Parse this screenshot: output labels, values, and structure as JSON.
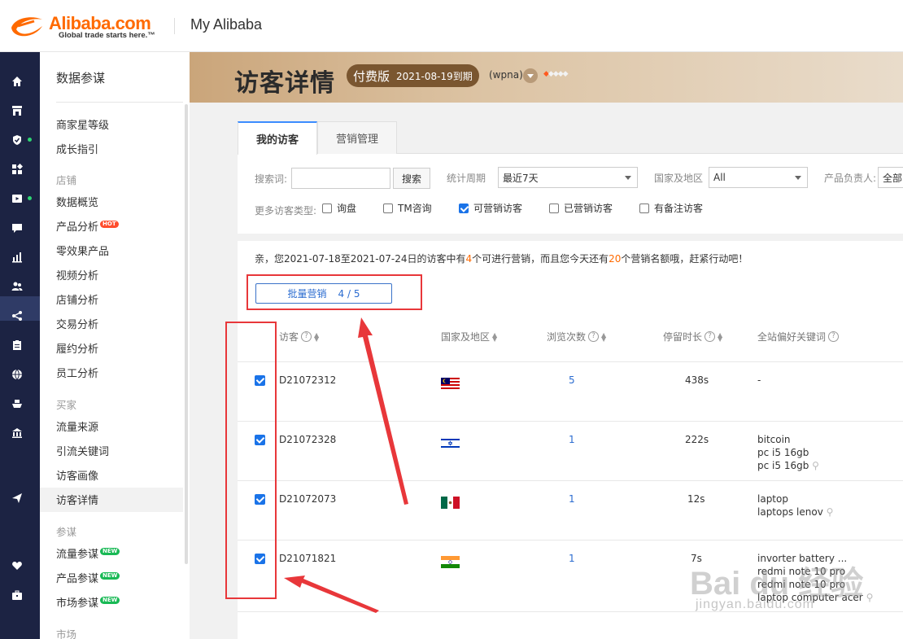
{
  "header": {
    "logo_text": "Alibaba.com",
    "logo_tagline": "Global trade starts here.™",
    "app_title": "My Alibaba"
  },
  "sidebar": {
    "title": "数据参谋",
    "items": [
      {
        "label": "商家星等级"
      },
      {
        "label": "成长指引"
      }
    ],
    "group_store": "店铺",
    "store_items": [
      {
        "label": "数据概览"
      },
      {
        "label": "产品分析",
        "badge": "HOT"
      },
      {
        "label": "零效果产品"
      },
      {
        "label": "视频分析"
      },
      {
        "label": "店铺分析"
      },
      {
        "label": "交易分析"
      },
      {
        "label": "履约分析"
      },
      {
        "label": "员工分析"
      }
    ],
    "group_buyer": "买家",
    "buyer_items": [
      {
        "label": "流量来源"
      },
      {
        "label": "引流关键词"
      },
      {
        "label": "访客画像"
      },
      {
        "label": "访客详情",
        "selected": true
      }
    ],
    "group_advisor": "参谋",
    "advisor_items": [
      {
        "label": "流量参谋",
        "badge": "NEW"
      },
      {
        "label": "产品参谋",
        "badge": "NEW"
      },
      {
        "label": "市场参谋",
        "badge": "NEW"
      }
    ],
    "group_market": "市场"
  },
  "rail_icons": [
    "home-icon",
    "store-icon",
    "shield-icon",
    "grid-icon",
    "video-icon",
    "chat-icon",
    "chart-icon",
    "users-icon",
    "share-icon",
    "clipboard-icon",
    "globe-icon",
    "ship-icon",
    "bank-icon",
    "send-icon",
    "heart-icon",
    "briefcase-icon"
  ],
  "banner": {
    "title": "访客详情",
    "edition": "付费版",
    "expiry": "2021-08-19到期",
    "user": "(wpna)",
    "diamonds": "◆◇◇◇◇"
  },
  "tabs": [
    {
      "label": "我的访客",
      "active": true
    },
    {
      "label": "营销管理",
      "active": false
    }
  ],
  "filters": {
    "search_label": "搜索词:",
    "search_value": "",
    "search_button": "搜索",
    "period_label": "统计周期",
    "period_value": "最近7天",
    "region_label": "国家及地区",
    "region_value": "All",
    "owner_label": "产品负责人:",
    "owner_value": "全部",
    "more_types_label": "更多访客类型:",
    "types": [
      {
        "label": "询盘",
        "checked": false
      },
      {
        "label": "TM咨询",
        "checked": false
      },
      {
        "label": "可营销访客",
        "checked": true
      },
      {
        "label": "已营销访客",
        "checked": false
      },
      {
        "label": "有备注访客",
        "checked": false
      }
    ]
  },
  "notice": {
    "part1": "亲，您2021-07-18至2021-07-24日的访客中有",
    "count1": "4",
    "part2": "个可进行营销，而且您今天还有",
    "count2": "20",
    "part3": "个营销名额哦，赶紧行动吧！"
  },
  "bulk": {
    "label": "批量营销",
    "count": "4 / 5"
  },
  "table": {
    "columns": [
      "访客",
      "国家及地区",
      "浏览次数",
      "停留时长",
      "全站偏好关键词"
    ],
    "rows": [
      {
        "visitor": "D21072312",
        "country": "Malaysia",
        "views": "5",
        "duration": "438s",
        "keywords": [
          "-"
        ],
        "checked": true
      },
      {
        "visitor": "D21072328",
        "country": "Israel",
        "views": "1",
        "duration": "222s",
        "keywords": [
          "bitcoin",
          "pc i5 16gb",
          "pc i5 16gb"
        ],
        "checked": true
      },
      {
        "visitor": "D21072073",
        "country": "Mexico",
        "views": "1",
        "duration": "12s",
        "keywords": [
          "laptop",
          "laptops lenov"
        ],
        "checked": true
      },
      {
        "visitor": "D21071821",
        "country": "India",
        "views": "1",
        "duration": "7s",
        "keywords": [
          "invorter battery ...",
          "redmi note 10 pro",
          "redmi note 10 pro",
          "laptop computer acer"
        ],
        "checked": true
      }
    ]
  },
  "watermark": {
    "main": "Bai du 经验",
    "sub": "jingyan.baidu.com"
  },
  "colors": {
    "accent": "#1a73e8",
    "brand_orange": "#ff6a00",
    "rail_bg": "#1c2343",
    "annotation_red": "#e8373a"
  }
}
